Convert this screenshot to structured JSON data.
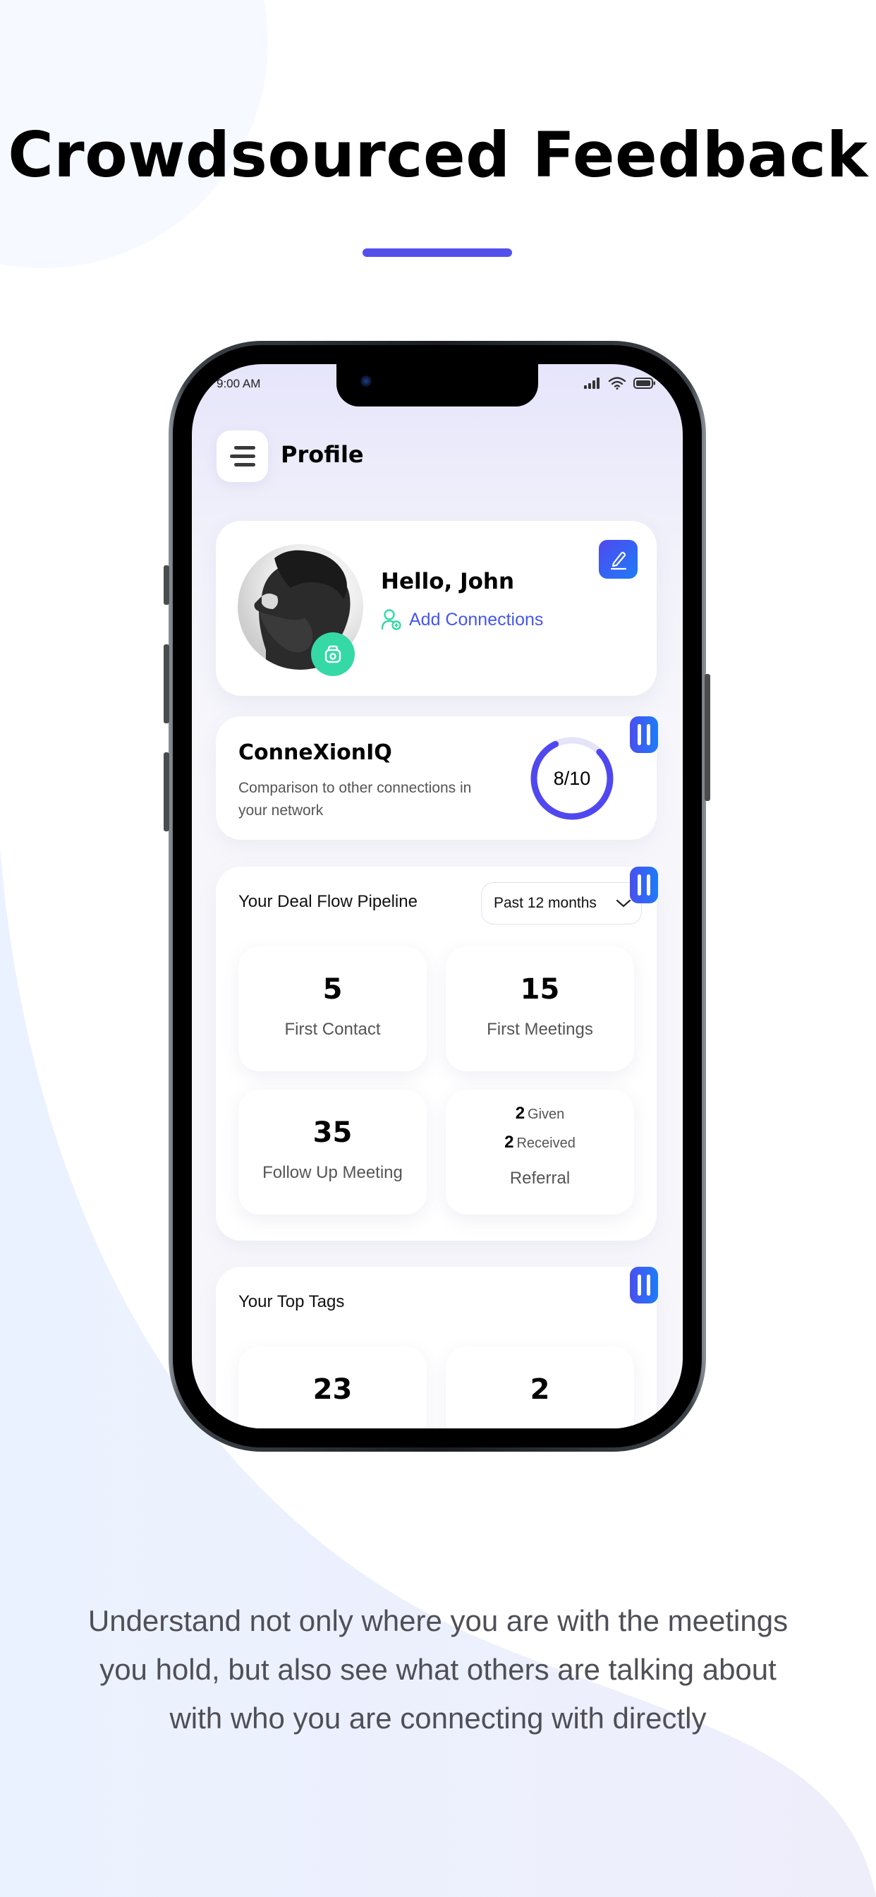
{
  "headline": "Crowdsourced Feedback",
  "tagline": [
    "Understand not only where you are with the meetings",
    "you hold, but also see what others are talking about",
    "with who you are connecting with directly"
  ],
  "colors": {
    "accent": "#5450ec",
    "blue": "#1d7cf7",
    "green": "#34d9a5",
    "link": "#4656ee"
  },
  "status_bar": {
    "time": "9:00 AM",
    "icons": [
      "signal-icon",
      "wifi-icon",
      "battery-icon"
    ]
  },
  "header": {
    "title": "Profile",
    "menu_icon": "hamburger-menu-icon"
  },
  "profile": {
    "greeting": "Hello, John",
    "add_connections": "Add Connections",
    "edit_icon": "pencil-icon",
    "camera_icon": "camera-icon"
  },
  "iq": {
    "title": "ConneXionIQ",
    "subtitle": "Comparison to other connections in your network",
    "score": 8,
    "max": 10,
    "score_label": "8/10"
  },
  "pipeline": {
    "title": "Your Deal Flow Pipeline",
    "period": "Past 12 months",
    "tiles": [
      {
        "value": "5",
        "label": "First Contact"
      },
      {
        "value": "15",
        "label": "First Meetings"
      },
      {
        "value": "35",
        "label": "Follow Up Meeting"
      }
    ],
    "referral": {
      "given_count": "2",
      "given_label": "Given",
      "received_count": "2",
      "received_label": "Received",
      "label": "Referral"
    }
  },
  "tags": {
    "title": "Your Top Tags",
    "tiles": [
      {
        "value": "23"
      },
      {
        "value": "2"
      }
    ]
  }
}
